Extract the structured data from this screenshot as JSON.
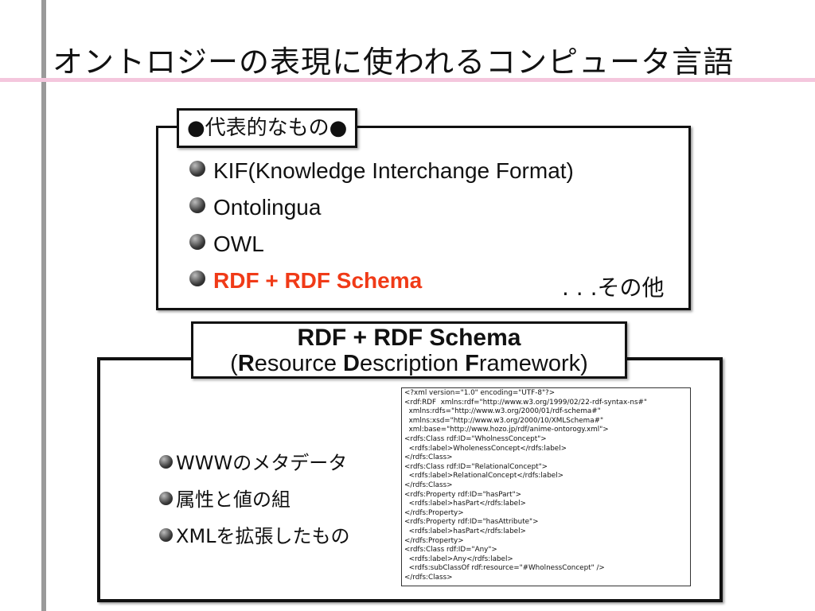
{
  "slide": {
    "title": "オントロジーの表現に使われるコンピュータ言語"
  },
  "representative": {
    "label": "●代表的なもの●",
    "items": [
      "KIF(Knowledge Interchange Format)",
      "Ontolingua",
      "OWL",
      "RDF + RDF Schema"
    ],
    "other": ". . .その他",
    "highlight_color": "#f03a17"
  },
  "rdf": {
    "heading": "RDF + RDF Schema",
    "expansion": {
      "open": "(",
      "r": "R",
      "r_rest": "esource ",
      "d": "D",
      "d_rest": "escription ",
      "f": "F",
      "f_rest": "ramework)"
    },
    "features": [
      "WWWのメタデータ",
      "属性と値の組",
      "XMLを拡張したもの"
    ],
    "code_lines": [
      "<?xml version=\"1.0\" encoding=\"UTF-8\"?>",
      "<rdf:RDF  xmlns:rdf=\"http://www.w3.org/1999/02/22-rdf-syntax-ns#\"",
      "  xmlns:rdfs=\"http://www.w3.org/2000/01/rdf-schema#\"",
      "  xmlns:xsd=\"http://www.w3.org/2000/10/XMLSchema#\"",
      "  xml:base=\"http://www.hozo.jp/rdf/anime-ontorogy.xml\">",
      "<rdfs:Class rdf:ID=\"WholnessConcept\">",
      "  <rdfs:label>WholenessConcept</rdfs:label>",
      "</rdfs:Class>",
      "<rdfs:Class rdf:ID=\"RelationalConcept\">",
      "  <rdfs:label>RelationalConcept</rdfs:label>",
      "</rdfs:Class>",
      "<rdfs:Property rdf:ID=\"hasPart\">",
      "  <rdfs:label>hasPart</rdfs:label>",
      "</rdfs:Property>",
      "<rdfs:Property rdf:ID=\"hasAttribute\">",
      "  <rdfs:label>hasPart</rdfs:label>",
      "</rdfs:Property>",
      "<rdfs:Class rdf:ID=\"Any\">",
      "  <rdfs:label>Any</rdfs:label>",
      "  <rdfs:subClassOf rdf:resource=\"#WholnessConcept\" />",
      "</rdfs:Class>"
    ]
  }
}
